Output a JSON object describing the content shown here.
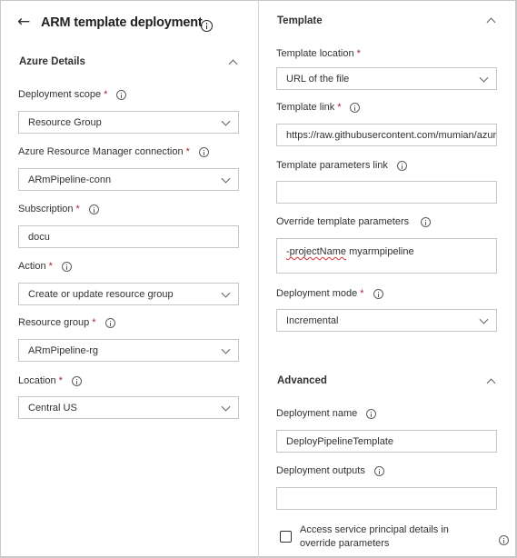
{
  "header": {
    "back_icon": "arrow-left-icon",
    "title": "ARM template deployment",
    "info_icon": "info-icon"
  },
  "left": {
    "section_title": "Azure Details",
    "fields": [
      {
        "label": "Deployment scope",
        "required": "*",
        "value": "Resource Group",
        "type": "dropdown"
      },
      {
        "label": "Azure Resource Manager connection",
        "required": "*",
        "value": "ARmPipeline-conn",
        "type": "dropdown"
      },
      {
        "label": "Subscription",
        "required": "*",
        "value": "docu",
        "type": "text"
      },
      {
        "label": "Action",
        "required": "*",
        "value": "Create or update resource group",
        "type": "dropdown"
      },
      {
        "label": "Resource group",
        "required": "*",
        "value": "ARmPipeline-rg",
        "type": "dropdown"
      },
      {
        "label": "Location",
        "required": "*",
        "value": "Central US",
        "type": "dropdown"
      }
    ]
  },
  "right": {
    "template_section": {
      "title": "Template",
      "template_location": {
        "label": "Template location",
        "required": "*",
        "value": "URL of the file"
      },
      "template_link": {
        "label": "Template link",
        "required": "*",
        "value": "https://raw.githubusercontent.com/mumian/azure-docs-json-samples/master/get-started-deployment/linked-template/azuredeploy.json"
      },
      "template_parameters_link": {
        "label": "Template parameters link",
        "value": ""
      },
      "override_parameters": {
        "label": "Override template parameters",
        "value_flagged": "-projectName",
        "value_rest": " myarmpipeline"
      },
      "deployment_mode": {
        "label": "Deployment mode",
        "required": "*",
        "value": "Incremental"
      }
    },
    "advanced_section": {
      "title": "Advanced",
      "deployment_name": {
        "label": "Deployment name",
        "value": "DeployPipelineTemplate"
      },
      "deployment_outputs": {
        "label": "Deployment outputs",
        "value": ""
      },
      "access_sp_checkbox": {
        "label": "Access service principal details in override parameters",
        "checked": false
      }
    }
  },
  "colors": {
    "required": "#a4262c",
    "border": "#c8c6c4",
    "divider": "#d6d6d6",
    "spellcheck": "#d13438"
  }
}
